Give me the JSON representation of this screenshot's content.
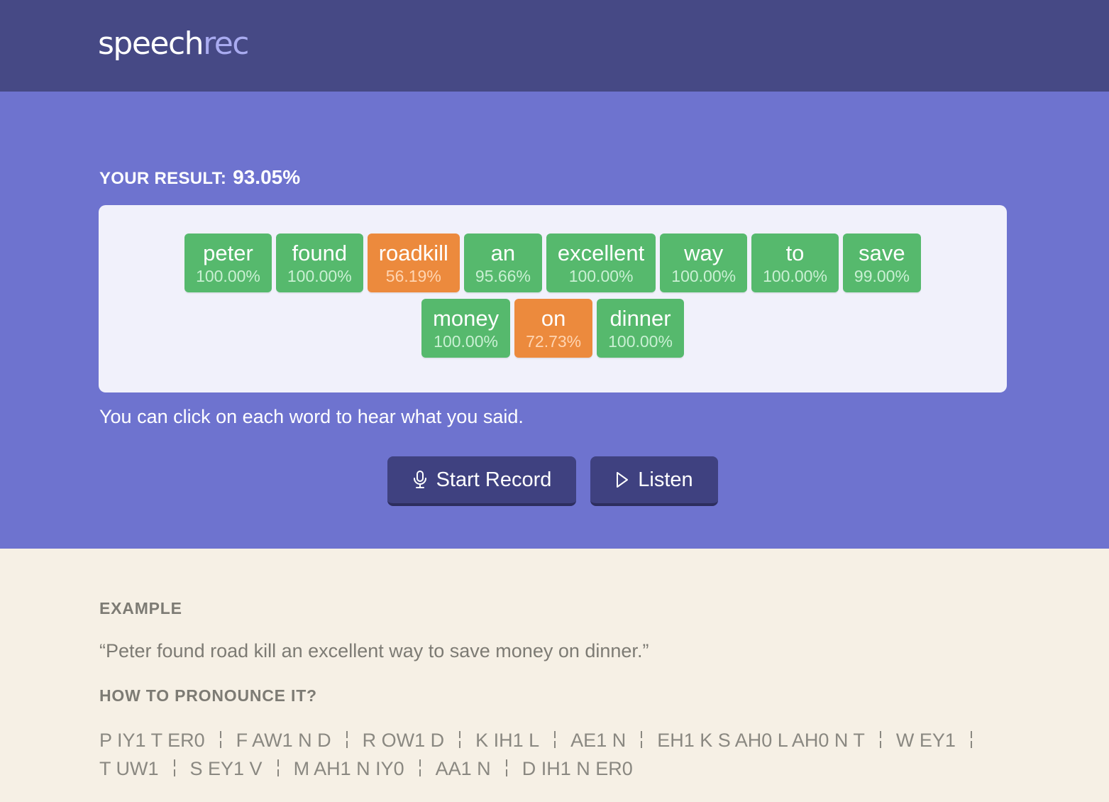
{
  "app": {
    "logo_main": "speech",
    "logo_accent": "rec"
  },
  "result": {
    "label": "YOUR RESULT:",
    "score": "93.05%"
  },
  "words": [
    {
      "word": "peter",
      "score": "100.00%",
      "status": "good"
    },
    {
      "word": "found",
      "score": "100.00%",
      "status": "good"
    },
    {
      "word": "roadkill",
      "score": "56.19%",
      "status": "warn"
    },
    {
      "word": "an",
      "score": "95.66%",
      "status": "good"
    },
    {
      "word": "excellent",
      "score": "100.00%",
      "status": "good"
    },
    {
      "word": "way",
      "score": "100.00%",
      "status": "good"
    },
    {
      "word": "to",
      "score": "100.00%",
      "status": "good"
    },
    {
      "word": "save",
      "score": "99.00%",
      "status": "good"
    },
    {
      "word": "money",
      "score": "100.00%",
      "status": "good"
    },
    {
      "word": "on",
      "score": "72.73%",
      "status": "warn"
    },
    {
      "word": "dinner",
      "score": "100.00%",
      "status": "good"
    }
  ],
  "hint": "You can click on each word to hear what you said.",
  "buttons": {
    "record_label": "Start Record",
    "record_icon": "microphone-icon",
    "listen_label": "Listen",
    "listen_icon": "play-icon"
  },
  "example": {
    "label": "EXAMPLE",
    "sentence": "“Peter found road kill an excellent way to save money on dinner.”",
    "howto_label": "HOW TO PRONOUNCE IT?",
    "phonemes": [
      "P IY1 T ER0",
      "F AW1 N D",
      "R OW1 D",
      "K IH1 L",
      "AE1 N",
      "EH1 K S AH0 L AH0 N T",
      "W EY1",
      "T UW1",
      "S EY1 V",
      "M AH1 N IY0",
      "AA1 N",
      "D IH1 N ER0"
    ]
  },
  "colors": {
    "header_bg": "#464985",
    "hero_bg": "#6e73cf",
    "card_bg": "#f1f1fb",
    "good": "#56b96d",
    "warn": "#ec8a3d",
    "button_bg": "#3f4180",
    "example_bg": "#f6f0e5"
  }
}
